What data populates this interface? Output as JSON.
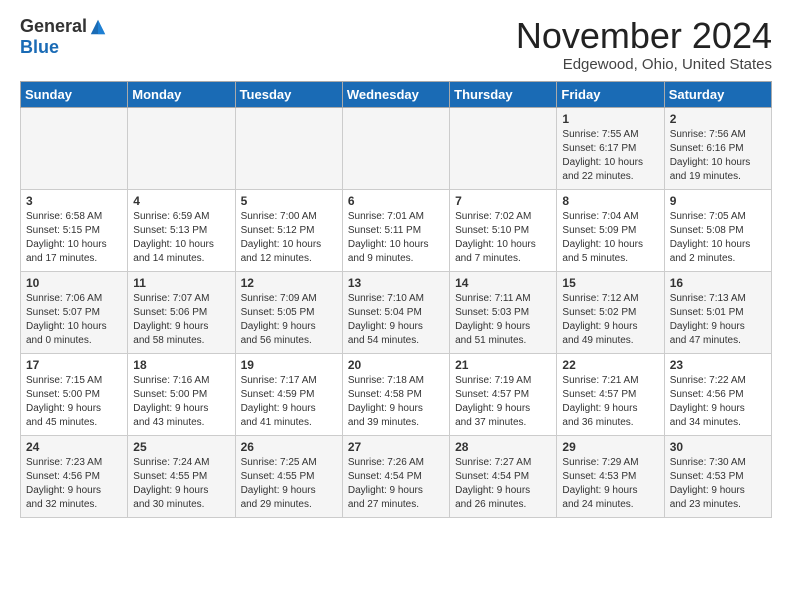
{
  "logo": {
    "general": "General",
    "blue": "Blue"
  },
  "title": "November 2024",
  "location": "Edgewood, Ohio, United States",
  "weekdays": [
    "Sunday",
    "Monday",
    "Tuesday",
    "Wednesday",
    "Thursday",
    "Friday",
    "Saturday"
  ],
  "weeks": [
    [
      {
        "day": "",
        "info": ""
      },
      {
        "day": "",
        "info": ""
      },
      {
        "day": "",
        "info": ""
      },
      {
        "day": "",
        "info": ""
      },
      {
        "day": "",
        "info": ""
      },
      {
        "day": "1",
        "info": "Sunrise: 7:55 AM\nSunset: 6:17 PM\nDaylight: 10 hours\nand 22 minutes."
      },
      {
        "day": "2",
        "info": "Sunrise: 7:56 AM\nSunset: 6:16 PM\nDaylight: 10 hours\nand 19 minutes."
      }
    ],
    [
      {
        "day": "3",
        "info": "Sunrise: 6:58 AM\nSunset: 5:15 PM\nDaylight: 10 hours\nand 17 minutes."
      },
      {
        "day": "4",
        "info": "Sunrise: 6:59 AM\nSunset: 5:13 PM\nDaylight: 10 hours\nand 14 minutes."
      },
      {
        "day": "5",
        "info": "Sunrise: 7:00 AM\nSunset: 5:12 PM\nDaylight: 10 hours\nand 12 minutes."
      },
      {
        "day": "6",
        "info": "Sunrise: 7:01 AM\nSunset: 5:11 PM\nDaylight: 10 hours\nand 9 minutes."
      },
      {
        "day": "7",
        "info": "Sunrise: 7:02 AM\nSunset: 5:10 PM\nDaylight: 10 hours\nand 7 minutes."
      },
      {
        "day": "8",
        "info": "Sunrise: 7:04 AM\nSunset: 5:09 PM\nDaylight: 10 hours\nand 5 minutes."
      },
      {
        "day": "9",
        "info": "Sunrise: 7:05 AM\nSunset: 5:08 PM\nDaylight: 10 hours\nand 2 minutes."
      }
    ],
    [
      {
        "day": "10",
        "info": "Sunrise: 7:06 AM\nSunset: 5:07 PM\nDaylight: 10 hours\nand 0 minutes."
      },
      {
        "day": "11",
        "info": "Sunrise: 7:07 AM\nSunset: 5:06 PM\nDaylight: 9 hours\nand 58 minutes."
      },
      {
        "day": "12",
        "info": "Sunrise: 7:09 AM\nSunset: 5:05 PM\nDaylight: 9 hours\nand 56 minutes."
      },
      {
        "day": "13",
        "info": "Sunrise: 7:10 AM\nSunset: 5:04 PM\nDaylight: 9 hours\nand 54 minutes."
      },
      {
        "day": "14",
        "info": "Sunrise: 7:11 AM\nSunset: 5:03 PM\nDaylight: 9 hours\nand 51 minutes."
      },
      {
        "day": "15",
        "info": "Sunrise: 7:12 AM\nSunset: 5:02 PM\nDaylight: 9 hours\nand 49 minutes."
      },
      {
        "day": "16",
        "info": "Sunrise: 7:13 AM\nSunset: 5:01 PM\nDaylight: 9 hours\nand 47 minutes."
      }
    ],
    [
      {
        "day": "17",
        "info": "Sunrise: 7:15 AM\nSunset: 5:00 PM\nDaylight: 9 hours\nand 45 minutes."
      },
      {
        "day": "18",
        "info": "Sunrise: 7:16 AM\nSunset: 5:00 PM\nDaylight: 9 hours\nand 43 minutes."
      },
      {
        "day": "19",
        "info": "Sunrise: 7:17 AM\nSunset: 4:59 PM\nDaylight: 9 hours\nand 41 minutes."
      },
      {
        "day": "20",
        "info": "Sunrise: 7:18 AM\nSunset: 4:58 PM\nDaylight: 9 hours\nand 39 minutes."
      },
      {
        "day": "21",
        "info": "Sunrise: 7:19 AM\nSunset: 4:57 PM\nDaylight: 9 hours\nand 37 minutes."
      },
      {
        "day": "22",
        "info": "Sunrise: 7:21 AM\nSunset: 4:57 PM\nDaylight: 9 hours\nand 36 minutes."
      },
      {
        "day": "23",
        "info": "Sunrise: 7:22 AM\nSunset: 4:56 PM\nDaylight: 9 hours\nand 34 minutes."
      }
    ],
    [
      {
        "day": "24",
        "info": "Sunrise: 7:23 AM\nSunset: 4:56 PM\nDaylight: 9 hours\nand 32 minutes."
      },
      {
        "day": "25",
        "info": "Sunrise: 7:24 AM\nSunset: 4:55 PM\nDaylight: 9 hours\nand 30 minutes."
      },
      {
        "day": "26",
        "info": "Sunrise: 7:25 AM\nSunset: 4:55 PM\nDaylight: 9 hours\nand 29 minutes."
      },
      {
        "day": "27",
        "info": "Sunrise: 7:26 AM\nSunset: 4:54 PM\nDaylight: 9 hours\nand 27 minutes."
      },
      {
        "day": "28",
        "info": "Sunrise: 7:27 AM\nSunset: 4:54 PM\nDaylight: 9 hours\nand 26 minutes."
      },
      {
        "day": "29",
        "info": "Sunrise: 7:29 AM\nSunset: 4:53 PM\nDaylight: 9 hours\nand 24 minutes."
      },
      {
        "day": "30",
        "info": "Sunrise: 7:30 AM\nSunset: 4:53 PM\nDaylight: 9 hours\nand 23 minutes."
      }
    ]
  ]
}
